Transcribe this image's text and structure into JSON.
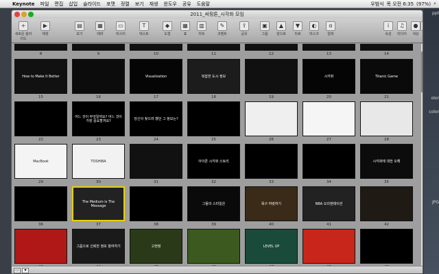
{
  "menubar": {
    "app": "Keynote",
    "items": [
      "파일",
      "편집",
      "삽입",
      "슬라이드",
      "포맷",
      "정렬",
      "보기",
      "재생",
      "윈도우",
      "공유",
      "도움말"
    ],
    "status": {
      "user": "우범식",
      "clock": "목 오전 6:35",
      "battery": "(97%)"
    }
  },
  "window": {
    "title": "2011_써핑톤_시각화 모임"
  },
  "toolbar": [
    {
      "name": "new-slide",
      "label": "새로운 슬라이드",
      "icon": "+"
    },
    {
      "name": "play",
      "label": "재생",
      "icon": "▶"
    },
    {
      "name": "view",
      "label": "보기",
      "icon": "▤"
    },
    {
      "name": "theme",
      "label": "테마",
      "icon": "▦"
    },
    {
      "name": "masters",
      "label": "마스터",
      "icon": "▭"
    },
    {
      "name": "text",
      "label": "텍스트",
      "icon": "T"
    },
    {
      "name": "shapes",
      "label": "도형",
      "icon": "◆"
    },
    {
      "name": "table",
      "label": "표",
      "icon": "▦"
    },
    {
      "name": "charts",
      "label": "차트",
      "icon": "▥"
    },
    {
      "name": "comment",
      "label": "코멘트",
      "icon": "✎"
    },
    {
      "name": "share",
      "label": "공유",
      "icon": "⇪"
    },
    {
      "name": "group",
      "label": "그룹",
      "icon": "▣"
    },
    {
      "name": "front",
      "label": "앞으로",
      "icon": "▲"
    },
    {
      "name": "back",
      "label": "뒤로",
      "icon": "▼"
    },
    {
      "name": "mask",
      "label": "마스크",
      "icon": "◐"
    },
    {
      "name": "alpha",
      "label": "알파",
      "icon": "α"
    },
    {
      "name": "inspector",
      "label": "속성",
      "icon": "i"
    },
    {
      "name": "media",
      "label": "미디어",
      "icon": "♫"
    },
    {
      "name": "colors",
      "label": "색상",
      "icon": "●"
    },
    {
      "name": "fonts",
      "label": "서체",
      "icon": "A"
    }
  ],
  "rows_partial_top": [
    "8",
    "9",
    "10",
    "11",
    "12",
    "13",
    "14"
  ],
  "slides": [
    {
      "n": "15",
      "bg": "#111",
      "text": "How to Make It Better"
    },
    {
      "n": "16",
      "bg": "#0c0c0c",
      "text": ""
    },
    {
      "n": "17",
      "bg": "#050505",
      "text": "Visualization"
    },
    {
      "n": "18",
      "bg": "#1c1c1c",
      "text": "복잡한 도시 정보"
    },
    {
      "n": "19",
      "bg": "#101010",
      "text": ""
    },
    {
      "n": "20",
      "bg": "#050505",
      "text": "시각화"
    },
    {
      "n": "21",
      "bg": "#0a0a0a",
      "text": "Titanic Game"
    },
    {
      "n": "22",
      "bg": "#000",
      "text": ""
    },
    {
      "n": "23",
      "bg": "#000",
      "text": "어느 것이 무엇일까요? 어느 것이 가장 중요할까요?"
    },
    {
      "n": "24",
      "bg": "#000",
      "text": "당신이 찾으려 했던 그 정보는?"
    },
    {
      "n": "25",
      "bg": "#000",
      "text": ""
    },
    {
      "n": "26",
      "bg": "#efefef",
      "text": ""
    },
    {
      "n": "27",
      "bg": "#f5f5f5",
      "text": ""
    },
    {
      "n": "28",
      "bg": "#e8e8e8",
      "text": ""
    },
    {
      "n": "29",
      "bg": "#f4f4f4",
      "text": "MacBook"
    },
    {
      "n": "30",
      "bg": "#f2f2f2",
      "text": "TOSHIBA"
    },
    {
      "n": "31",
      "bg": "#111",
      "text": ""
    },
    {
      "n": "32",
      "bg": "#000",
      "text": "아이폰 시각화 스토리"
    },
    {
      "n": "33",
      "bg": "#000",
      "text": ""
    },
    {
      "n": "34",
      "bg": "#000",
      "text": ""
    },
    {
      "n": "35",
      "bg": "#0c0c0c",
      "text": "시각화에 대한 오해"
    },
    {
      "n": "36",
      "bg": "#000",
      "text": ""
    },
    {
      "n": "37",
      "bg": "#222",
      "text": "The Medium is The Message"
    },
    {
      "n": "38",
      "bg": "#000",
      "text": ""
    },
    {
      "n": "39",
      "bg": "#0a0a0a",
      "text": "그들의 스타일은"
    },
    {
      "n": "40",
      "bg": "#3a2a18",
      "text": "욕구 여럿하기"
    },
    {
      "n": "41",
      "bg": "#222",
      "text": "NBA 오리엔테이션"
    },
    {
      "n": "42",
      "bg": "#201a14",
      "text": ""
    },
    {
      "n": "43",
      "bg": "#b01818",
      "text": ""
    },
    {
      "n": "44",
      "bg": "#1a1a1a",
      "text": "그룹으로 신뢰한 정보 참여하기"
    },
    {
      "n": "45",
      "bg": "#2a3a18",
      "text": "고현정"
    },
    {
      "n": "46",
      "bg": "#3c5a20",
      "text": ""
    },
    {
      "n": "47",
      "bg": "#1a4a3a",
      "text": "LEVEL UP"
    },
    {
      "n": "48",
      "bg": "#c8261b",
      "text": ""
    },
    {
      "n": "49",
      "bg": "#000",
      "text": ""
    }
  ],
  "selected_slide": "37",
  "desktop": {
    "labels": [
      "ppt",
      "olor",
      "color",
      "JPG"
    ]
  }
}
